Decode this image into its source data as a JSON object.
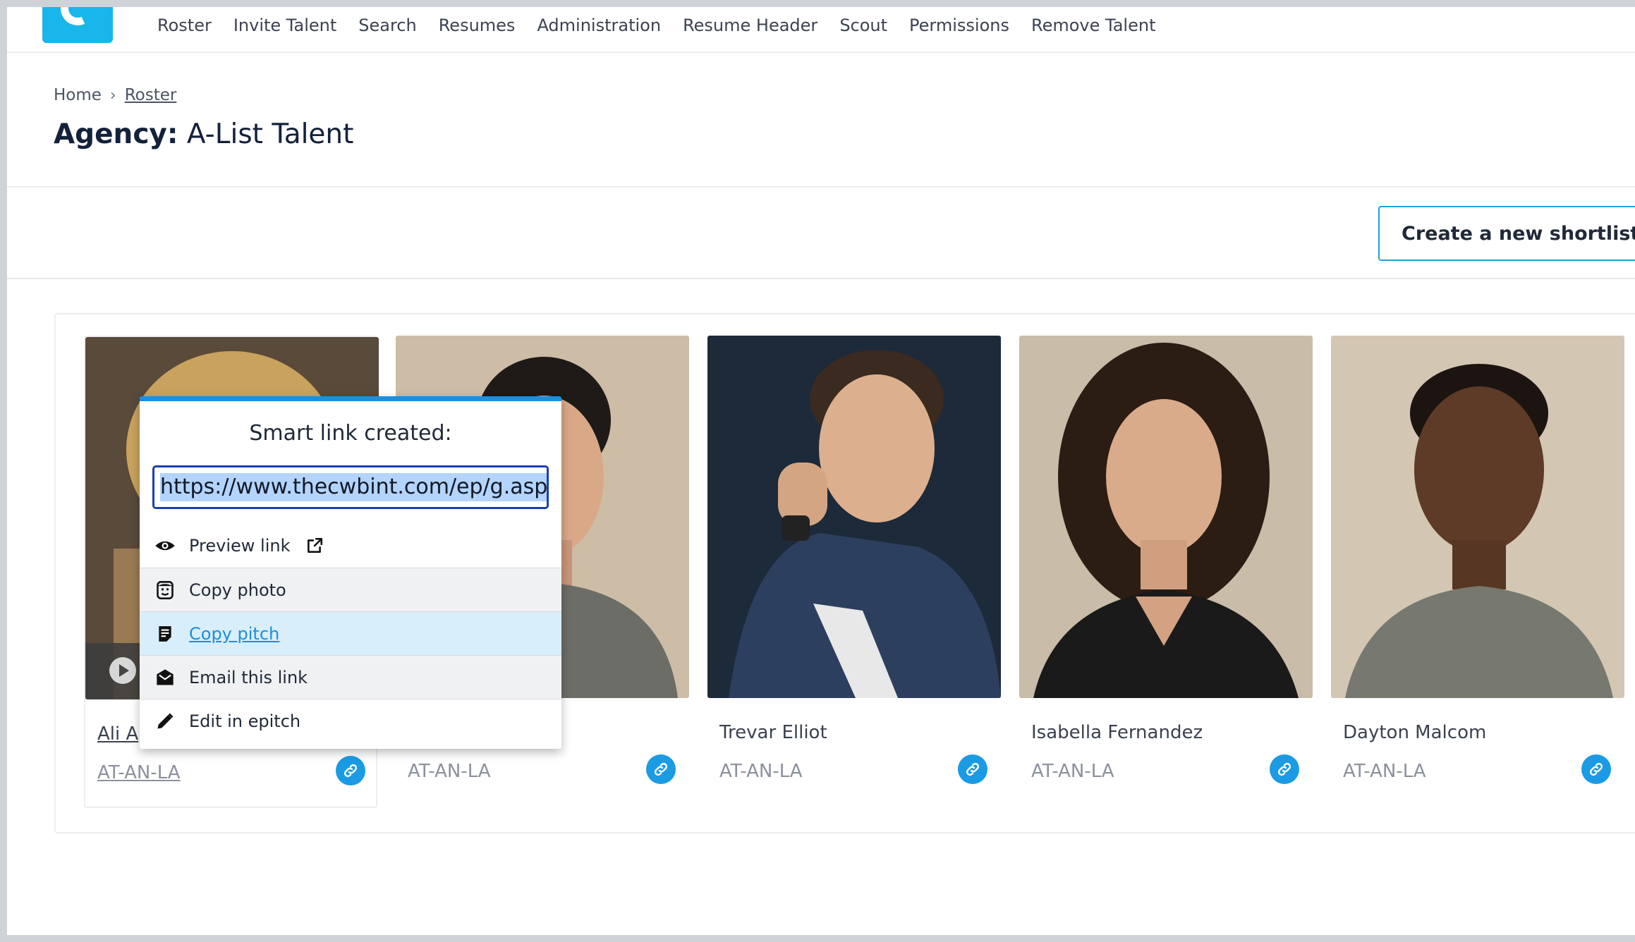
{
  "nav": {
    "items": [
      "Roster",
      "Invite Talent",
      "Search",
      "Resumes",
      "Administration",
      "Resume Header",
      "Scout",
      "Permissions",
      "Remove Talent"
    ]
  },
  "breadcrumb": {
    "home": "Home",
    "separator": "›",
    "current": "Roster"
  },
  "page": {
    "title_label": "Agency:",
    "title_value": "A-List Talent"
  },
  "actions": {
    "create_shortlist": "Create a new shortlist"
  },
  "talent": [
    {
      "name": "Ali A",
      "code": "AT-AN-LA"
    },
    {
      "name": "",
      "code": "AT-AN-LA"
    },
    {
      "name": "Trevar Elliot",
      "code": "AT-AN-LA"
    },
    {
      "name": "Isabella Fernandez",
      "code": "AT-AN-LA"
    },
    {
      "name": "Dayton Malcom",
      "code": "AT-AN-LA"
    }
  ],
  "popup": {
    "title": "Smart link created:",
    "url": "https://www.thecwbint.com/ep/g.asp",
    "items": [
      {
        "label": "Preview link",
        "icon": "eye-icon"
      },
      {
        "label": "Copy photo",
        "icon": "face-icon"
      },
      {
        "label": "Copy pitch",
        "icon": "document-icon"
      },
      {
        "label": "Email this link",
        "icon": "envelope-icon"
      },
      {
        "label": "Edit in epitch",
        "icon": "pencil-icon"
      }
    ]
  },
  "colors": {
    "accent": "#1b9be3",
    "logo": "#19b6ec",
    "title": "#13213b"
  }
}
